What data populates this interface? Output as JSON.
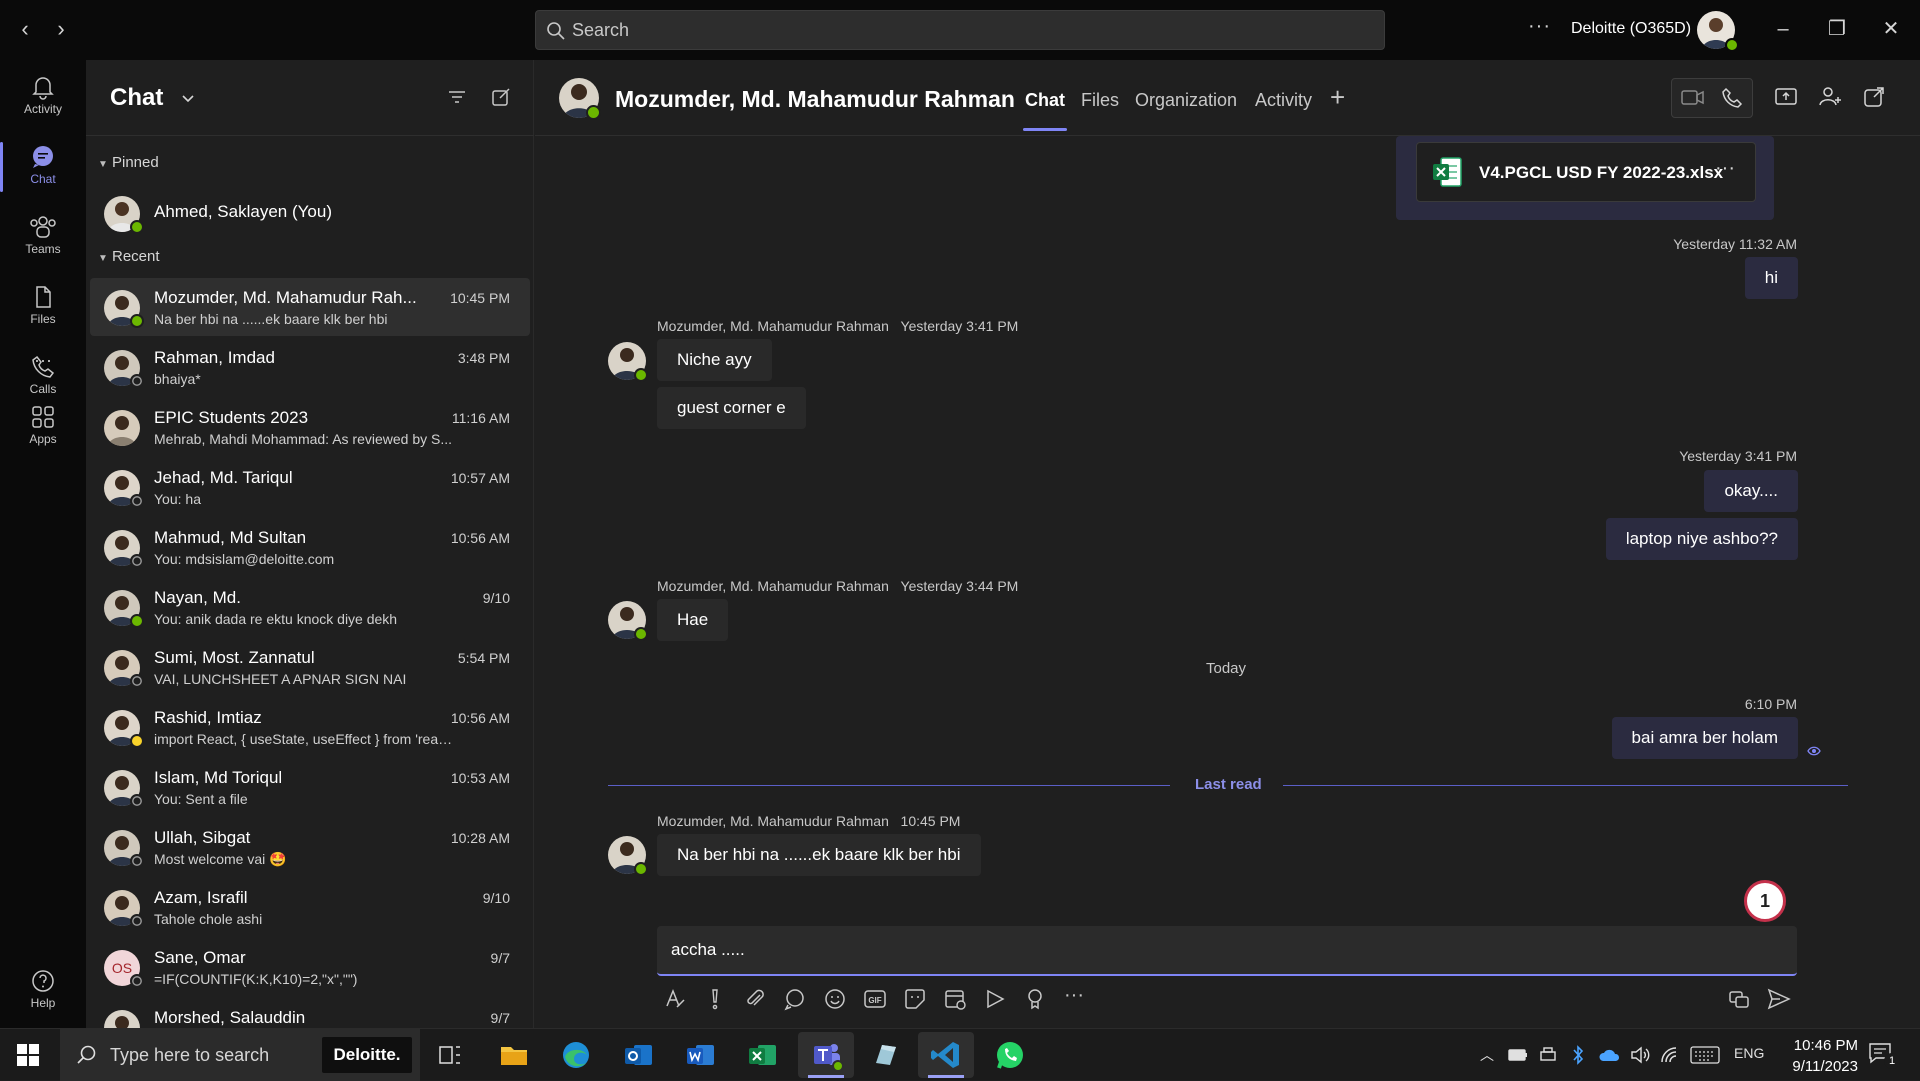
{
  "titlebar": {
    "search_placeholder": "Search",
    "more": "···",
    "org_name": "Deloitte (O365D)"
  },
  "rail": {
    "items": [
      {
        "label": "Activity",
        "icon": "bell-icon"
      },
      {
        "label": "Chat",
        "icon": "chat-icon"
      },
      {
        "label": "Teams",
        "icon": "teams-icon"
      },
      {
        "label": "Files",
        "icon": "file-icon"
      },
      {
        "label": "Calls",
        "icon": "phone-icon"
      },
      {
        "label": "Apps",
        "icon": "apps-icon"
      },
      {
        "label": "Help",
        "icon": "help-icon"
      }
    ],
    "more": "···"
  },
  "chatlist": {
    "title": "Chat",
    "pinned_label": "Pinned",
    "recent_label": "Recent",
    "pinned": [
      {
        "name": "Ahmed, Saklayen (You)",
        "status": "available"
      }
    ],
    "recent": [
      {
        "name": "Mozumder, Md. Mahamudur Rah...",
        "preview": "Na ber hbi na ......ek baare klk ber hbi",
        "time": "10:45 PM",
        "status": "available",
        "active": true
      },
      {
        "name": "Rahman, Imdad",
        "preview": "bhaiya*",
        "time": "3:48 PM",
        "status": "offline"
      },
      {
        "name": "EPIC Students 2023",
        "preview": "Mehrab, Mahdi Mohammad: As reviewed by S...",
        "time": "11:16 AM",
        "status": "group"
      },
      {
        "name": "Jehad, Md. Tariqul",
        "preview": "You: ha",
        "time": "10:57 AM",
        "status": "offline"
      },
      {
        "name": "Mahmud, Md Sultan",
        "preview": "You: mdsislam@deloitte.com",
        "time": "10:56 AM",
        "status": "offline"
      },
      {
        "name": "Nayan, Md.",
        "preview": "You: anik dada re ektu knock diye dekh",
        "time": "9/10",
        "status": "available"
      },
      {
        "name": "Sumi, Most. Zannatul",
        "preview": "VAI, LUNCHSHEET A APNAR SIGN NAI",
        "time": "5:54 PM",
        "status": "offline"
      },
      {
        "name": "Rashid, Imtiaz",
        "preview": "import React, { useState, useEffect } from 'reac...",
        "time": "10:56 AM",
        "status": "away"
      },
      {
        "name": "Islam, Md Toriqul",
        "preview": "You: Sent a file",
        "time": "10:53 AM",
        "status": "offline"
      },
      {
        "name": "Ullah, Sibgat",
        "preview": "Most welcome vai 🤩",
        "time": "10:28 AM",
        "status": "offline"
      },
      {
        "name": "Azam, Israfil",
        "preview": "Tahole chole ashi",
        "time": "9/10",
        "status": "offline"
      },
      {
        "name": "Sane, Omar",
        "preview": "=IF(COUNTIF(K:K,K10)=2,\"x\",\"\")",
        "time": "9/7",
        "status": "offline",
        "initials": "OS"
      },
      {
        "name": "Morshed, Salauddin",
        "preview": "",
        "time": "9/7",
        "status": "offline"
      }
    ]
  },
  "pane": {
    "contact_name": "Mozumder, Md. Mahamudur Rahman",
    "tabs": [
      "Chat",
      "Files",
      "Organization",
      "Activity"
    ],
    "add_tab": "+",
    "file_attachment": {
      "name": "V4.PGCL USD FY 2022-23.xlsx",
      "more": "···"
    },
    "messages": {
      "out1_meta": "Yesterday 11:32 AM",
      "out1_text": "hi",
      "in1_meta_name": "Mozumder, Md. Mahamudur Rahman",
      "in1_meta_time": "Yesterday 3:41 PM",
      "in1_a": "Niche ayy",
      "in1_b": "guest corner e",
      "out2_meta": "Yesterday 3:41 PM",
      "out2_a": "okay....",
      "out2_b": "laptop niye ashbo??",
      "in2_meta_name": "Mozumder, Md. Mahamudur Rahman",
      "in2_meta_time": "Yesterday 3:44 PM",
      "in2_a": "Hae",
      "day_separator": "Today",
      "out3_meta": "6:10 PM",
      "out3_text": "bai amra ber holam",
      "last_read": "Last read",
      "in3_meta_name": "Mozumder, Md. Mahamudur Rahman",
      "in3_meta_time": "10:45 PM",
      "in3_a": "Na ber hbi na ......ek baare klk ber hbi"
    },
    "unread_count": "1",
    "composer_value": "accha ....."
  },
  "taskbar": {
    "search_placeholder": "Type here to search",
    "brand": "Deloitte.",
    "language": "ENG",
    "time": "10:46 PM",
    "date": "9/11/2023",
    "notification_count": "1"
  },
  "colors": {
    "accent": "#7f85f5",
    "available": "#6bb700",
    "away": "#f8d22a",
    "unread_ring": "#c4314b"
  }
}
